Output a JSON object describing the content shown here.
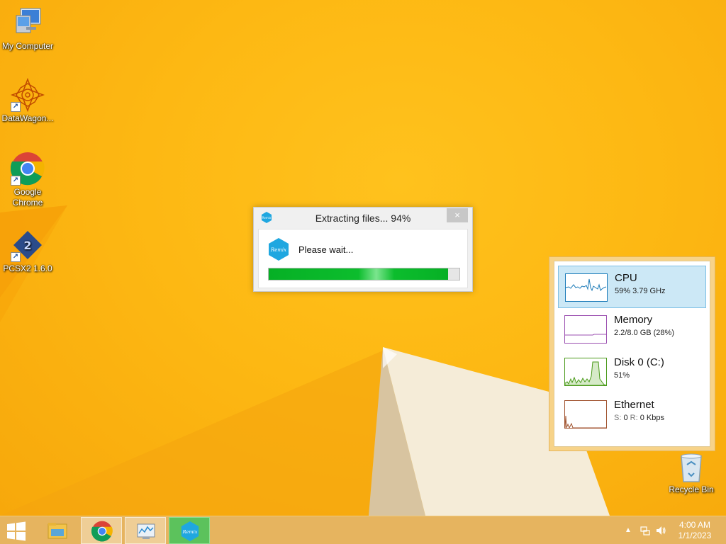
{
  "desktop": {
    "icons": [
      {
        "label": "My Computer"
      },
      {
        "label": "DataWagon..."
      },
      {
        "label": "Google Chrome"
      },
      {
        "label": "PCSX2 1.6.0"
      },
      {
        "label": "Recycle Bin"
      }
    ]
  },
  "dialog": {
    "title": "Extracting files... 94%",
    "close": "×",
    "message": "Please wait...",
    "progress": 0.94
  },
  "performance": {
    "items": [
      {
        "name": "CPU",
        "stat": "59% 3.79 GHz",
        "color": "#4a90c2",
        "selected": true
      },
      {
        "name": "Memory",
        "stat": "2.2/8.0 GB (28%)",
        "color": "#9b4fb0"
      },
      {
        "name": "Disk 0 (C:)",
        "stat": "51%",
        "color": "#4a9a1a"
      },
      {
        "name": "Ethernet",
        "stat_s_label": "S:",
        "stat_s": "0",
        "stat_r_label": "R:",
        "stat_r": "0 Kbps",
        "color": "#a0522d"
      }
    ]
  },
  "taskbar": {
    "clock_time": "4:00 AM",
    "clock_date": "1/1/2023",
    "buttons": [
      "file-explorer",
      "google-chrome",
      "task-manager",
      "remix-os-installer"
    ]
  }
}
